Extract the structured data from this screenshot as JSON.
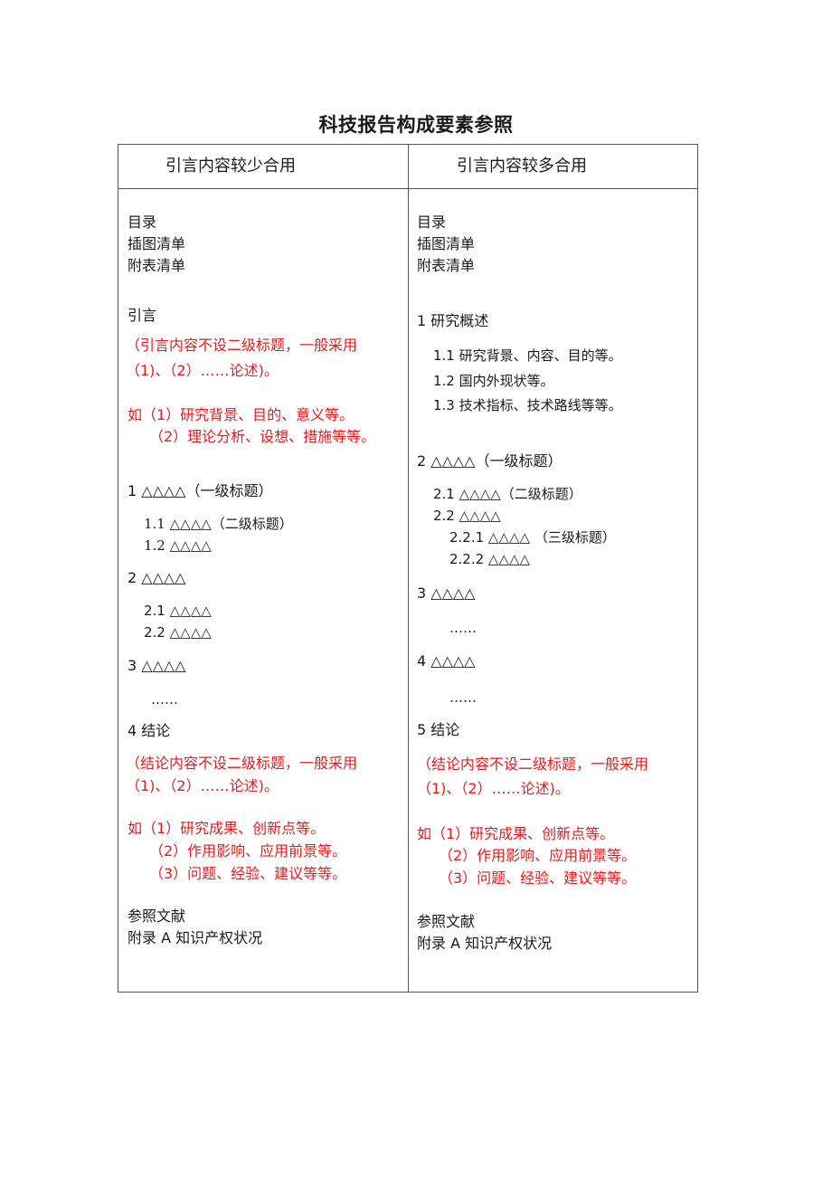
{
  "title": "科技报告构成要素参照",
  "columns": {
    "left": {
      "header": "引言内容较少合用",
      "front": [
        "目录",
        "插图清单",
        "附表清单"
      ],
      "intro": "引言",
      "intro_note": [
        "（引言内容不设二级标题，一般采用",
        "（1)、（2）……论述)。"
      ],
      "intro_example": [
        "如（1）研究背景、目的、意义等。",
        "（2）理论分析、设想、措施等等。"
      ],
      "sections": [
        {
          "text": "1 △△△△（一级标题）"
        },
        {
          "text": "1.1 △△△△（二级标题）"
        },
        {
          "text": "1.2 △△△△"
        },
        {
          "text": "2 △△△△"
        },
        {
          "text": "2.1 △△△△"
        },
        {
          "text": "2.2 △△△△"
        },
        {
          "text": "3 △△△△"
        },
        {
          "text": "……"
        },
        {
          "text": "4 结论"
        }
      ],
      "concl_note": [
        "（结论内容不设二级标题，一般采用",
        "（1)、（2）……论述)。"
      ],
      "concl_example": [
        "如（1）研究成果、创新点等。",
        "（2）作用影响、应用前景等。",
        "（3）问题、经验、建议等等。"
      ],
      "back": [
        "参照文献",
        "附录 A  知识产权状况"
      ]
    },
    "right": {
      "header": "引言内容较多合用",
      "front": [
        "目录",
        "插图清单",
        "附表清单"
      ],
      "sections": [
        {
          "text": "1 研究概述"
        },
        {
          "text": "1.1 研究背景、内容、目的等。"
        },
        {
          "text": "1.2 国内外现状等。"
        },
        {
          "text": "1.3 技术指标、技术路线等等。"
        },
        {
          "text": "2 △△△△（一级标题）"
        },
        {
          "text": "2.1 △△△△（二级标题）"
        },
        {
          "text": "2.2 △△△△"
        },
        {
          "text": "2.2.1 △△△△ （三级标题）"
        },
        {
          "text": "2.2.2 △△△△"
        },
        {
          "text": "3 △△△△"
        },
        {
          "text": "……"
        },
        {
          "text": "4 △△△△"
        },
        {
          "text": "……"
        },
        {
          "text": "5 结论"
        }
      ],
      "concl_note": [
        "（结论内容不设二级标题，一般采用",
        "（1)、（2）……论述)。"
      ],
      "concl_example": [
        "如（1）研究成果、创新点等。",
        "（2）作用影响、应用前景等。",
        "（3）问题、经验、建议等等。"
      ],
      "back": [
        "参照文献",
        "附录 A  知识产权状况"
      ]
    }
  },
  "colors": {
    "note": "#e8191c",
    "text": "#1a1a1a",
    "border": "#555555"
  }
}
